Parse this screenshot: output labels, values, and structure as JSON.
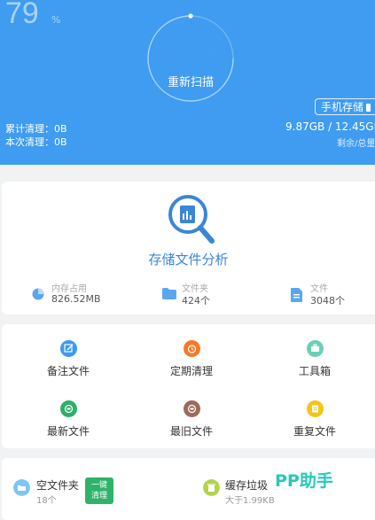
{
  "header": {
    "percent": "79",
    "percent_unit": "%",
    "rescan_label": "重新扫描",
    "storage_pill": "手机存储",
    "cumulative_label": "累计清理：0B",
    "current_label": "本次清理：0B",
    "capacity": "9.87GB / 12.45GB",
    "capacity_sub": "剩余/总量"
  },
  "analysis": {
    "title": "存储文件分析",
    "items": [
      {
        "label": "内存占用",
        "value": "826.52MB",
        "icon": "pie-chart-icon"
      },
      {
        "label": "文件夹",
        "value": "424个",
        "icon": "folder-icon"
      },
      {
        "label": "文件",
        "value": "3048个",
        "icon": "document-icon"
      }
    ]
  },
  "tools": [
    {
      "label": "备注文件",
      "icon": "edit-icon",
      "color": "#3b9af0"
    },
    {
      "label": "定期清理",
      "icon": "alarm-clock-icon",
      "color": "#f47a2b"
    },
    {
      "label": "工具箱",
      "icon": "toolbox-icon",
      "color": "#6cd0b8"
    },
    {
      "label": "最新文件",
      "icon": "new-file-icon",
      "color": "#2fae6a"
    },
    {
      "label": "最旧文件",
      "icon": "old-file-icon",
      "color": "#9c6a5c"
    },
    {
      "label": "重复文件",
      "icon": "duplicate-file-icon",
      "color": "#f5c518"
    }
  ],
  "bottom": {
    "empty_folder_title": "空文件夹",
    "empty_folder_count": "18个",
    "one_click_line1": "一键",
    "one_click_line2": "清理",
    "cache_title": "缓存垃圾",
    "cache_sub": "大于1.99KB"
  },
  "watermark": "PP助手"
}
